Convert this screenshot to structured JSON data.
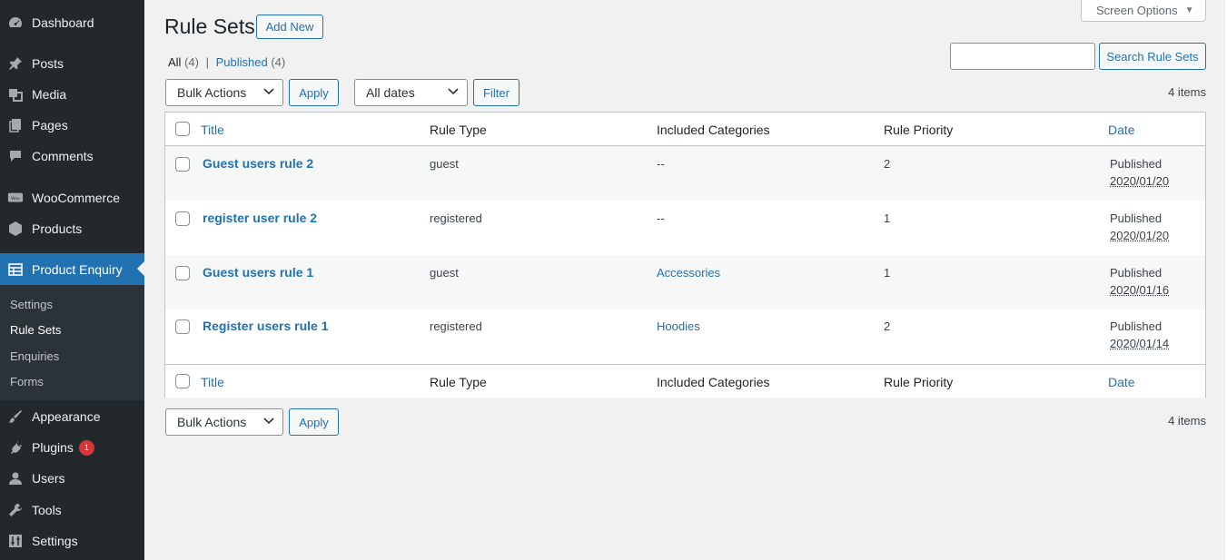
{
  "sidebar": {
    "items": [
      {
        "label": "Dashboard",
        "icon": "dashboard-icon"
      },
      {
        "label": "Posts",
        "icon": "pin-icon"
      },
      {
        "label": "Media",
        "icon": "media-icon"
      },
      {
        "label": "Pages",
        "icon": "pages-icon"
      },
      {
        "label": "Comments",
        "icon": "comment-icon"
      },
      {
        "label": "WooCommerce",
        "icon": "woo-icon"
      },
      {
        "label": "Products",
        "icon": "box-icon"
      },
      {
        "label": "Product Enquiry",
        "icon": "table-icon"
      },
      {
        "label": "Appearance",
        "icon": "brush-icon"
      },
      {
        "label": "Plugins",
        "icon": "plug-icon",
        "badge": "1"
      },
      {
        "label": "Users",
        "icon": "user-icon"
      },
      {
        "label": "Tools",
        "icon": "wrench-icon"
      },
      {
        "label": "Settings",
        "icon": "sliders-icon"
      }
    ],
    "submenu": [
      "Settings",
      "Rule Sets",
      "Enquiries",
      "Forms"
    ]
  },
  "header": {
    "title": "Rule Sets",
    "add_new": "Add New",
    "screen_options": "Screen Options"
  },
  "filters": {
    "all_label": "All",
    "all_count": "(4)",
    "separator": "|",
    "published_label": "Published",
    "published_count": "(4)"
  },
  "search": {
    "value": "",
    "button": "Search Rule Sets"
  },
  "toolbar_top": {
    "bulk_actions": "Bulk Actions",
    "apply": "Apply",
    "dates": "All dates",
    "filter": "Filter",
    "count": "4 items"
  },
  "toolbar_bottom": {
    "bulk_actions": "Bulk Actions",
    "apply": "Apply",
    "count": "4 items"
  },
  "table": {
    "columns": {
      "title": "Title",
      "rule_type": "Rule Type",
      "categories": "Included Categories",
      "priority": "Rule Priority",
      "date": "Date"
    },
    "rows": [
      {
        "title": "Guest users rule 2",
        "rule_type": "guest",
        "categories": "--",
        "priority": "2",
        "status": "Published",
        "date": "2020/01/20"
      },
      {
        "title": "register user rule 2",
        "rule_type": "registered",
        "categories": "--",
        "priority": "1",
        "status": "Published",
        "date": "2020/01/20"
      },
      {
        "title": "Guest users rule 1",
        "rule_type": "guest",
        "categories": "Accessories",
        "priority": "1",
        "status": "Published",
        "date": "2020/01/16"
      },
      {
        "title": "Register users rule 1",
        "rule_type": "registered",
        "categories": "Hoodies",
        "priority": "2",
        "status": "Published",
        "date": "2020/01/14"
      }
    ]
  },
  "colors": {
    "sidebar": "#23282d",
    "accent": "#2271b1",
    "badge": "#d63638"
  }
}
